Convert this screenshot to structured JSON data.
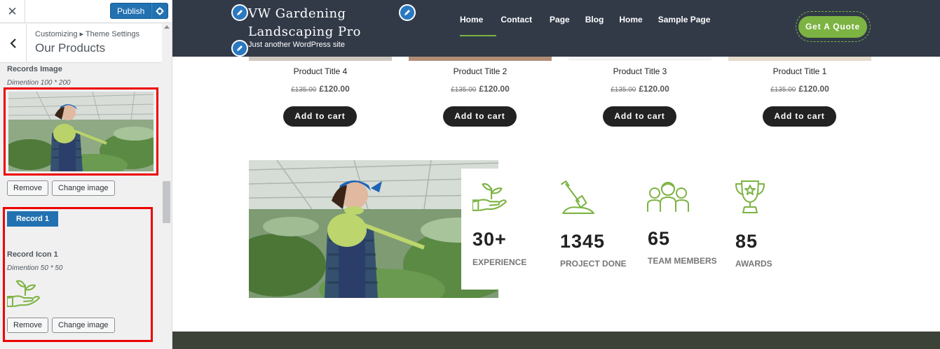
{
  "customizer": {
    "close_label": "✕",
    "publish_label": "Publish",
    "breadcrumb": "Customizing ▸ Theme Settings",
    "section_title": "Our Products",
    "records_image_label": "Records Image",
    "records_image_desc": "Dimention 100 * 200",
    "remove_label": "Remove",
    "change_image_label": "Change image",
    "record_tab_label": "Record 1",
    "record_icon_label": "Record Icon 1",
    "record_icon_desc": "Dimention 50 * 50",
    "remove_label_2": "Remove",
    "change_image_label_2": "Change image",
    "highlight_color": "#ee0000",
    "accent_color": "#2271b1"
  },
  "site": {
    "title_line1": "VW Gardening",
    "title_line2": "Landscaping Pro",
    "tagline": "Just another WordPress site",
    "nav": [
      "Home",
      "Contact",
      "Page",
      "Blog",
      "Home",
      "Sample Page"
    ],
    "active_nav": "Home",
    "quote_label": "Get A Quote",
    "header_color": "#323a48",
    "accent_color": "#7cb342"
  },
  "products": [
    {
      "title": "Product Title 4",
      "old_price": "£135.00",
      "price": "£120.00",
      "button": "Add to cart"
    },
    {
      "title": "Product Title 2",
      "old_price": "£135.00",
      "price": "£120.00",
      "button": "Add to cart"
    },
    {
      "title": "Product Title 3",
      "old_price": "£135.00",
      "price": "£120.00",
      "button": "Add to cart"
    },
    {
      "title": "Product Title 1",
      "old_price": "£135.00",
      "price": "£120.00",
      "button": "Add to cart"
    }
  ],
  "stats": [
    {
      "value": "30+",
      "label": "EXPERIENCE",
      "icon": "plant-in-hand-icon"
    },
    {
      "value": "1345",
      "label": "PROJECT DONE",
      "icon": "shovel-icon"
    },
    {
      "value": "65",
      "label": "TEAM MEMBERS",
      "icon": "team-icon"
    },
    {
      "value": "85",
      "label": "AWARDS",
      "icon": "trophy-icon"
    }
  ]
}
